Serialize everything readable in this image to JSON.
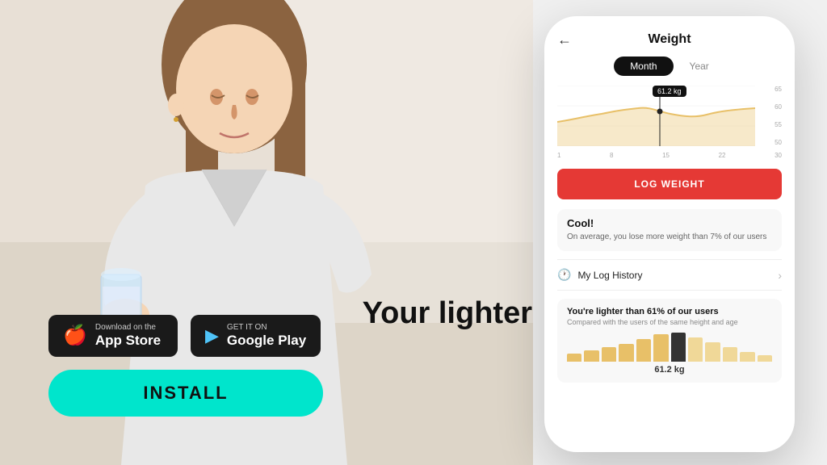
{
  "bg": {
    "alt": "Woman drinking from a glass cup"
  },
  "hero": {
    "line1": "Your lighter"
  },
  "app_store": {
    "small_text": "Download on the",
    "big_text": "App Store",
    "icon": "🍎"
  },
  "google_play": {
    "small_text": "GET IT ON",
    "big_text": "Google Play",
    "icon": "▶"
  },
  "install_btn": "INSTALL",
  "phone": {
    "header_title": "Weight",
    "back_icon": "←",
    "tab_month": "Month",
    "tab_year": "Year",
    "tooltip_value": "61.2 kg",
    "x_labels": [
      "1",
      "8",
      "15",
      "22",
      "30"
    ],
    "y_labels": [
      "65",
      "60",
      "55",
      "50"
    ],
    "log_weight_btn": "LOG WEIGHT",
    "cool_card": {
      "title": "Cool!",
      "desc": "On average, you lose more weight than 7% of our users"
    },
    "log_history": {
      "icon": "🕐",
      "label": "My Log History"
    },
    "lighter_card": {
      "title": "You're lighter than 61% of our users",
      "desc": "Compared with the users of the same height and age",
      "weight": "61.2 kg"
    }
  },
  "colors": {
    "accent_red": "#e53935",
    "accent_teal": "#00e5cc",
    "bar_gold": "#e8c068",
    "bar_light_gold": "#f0d898"
  }
}
